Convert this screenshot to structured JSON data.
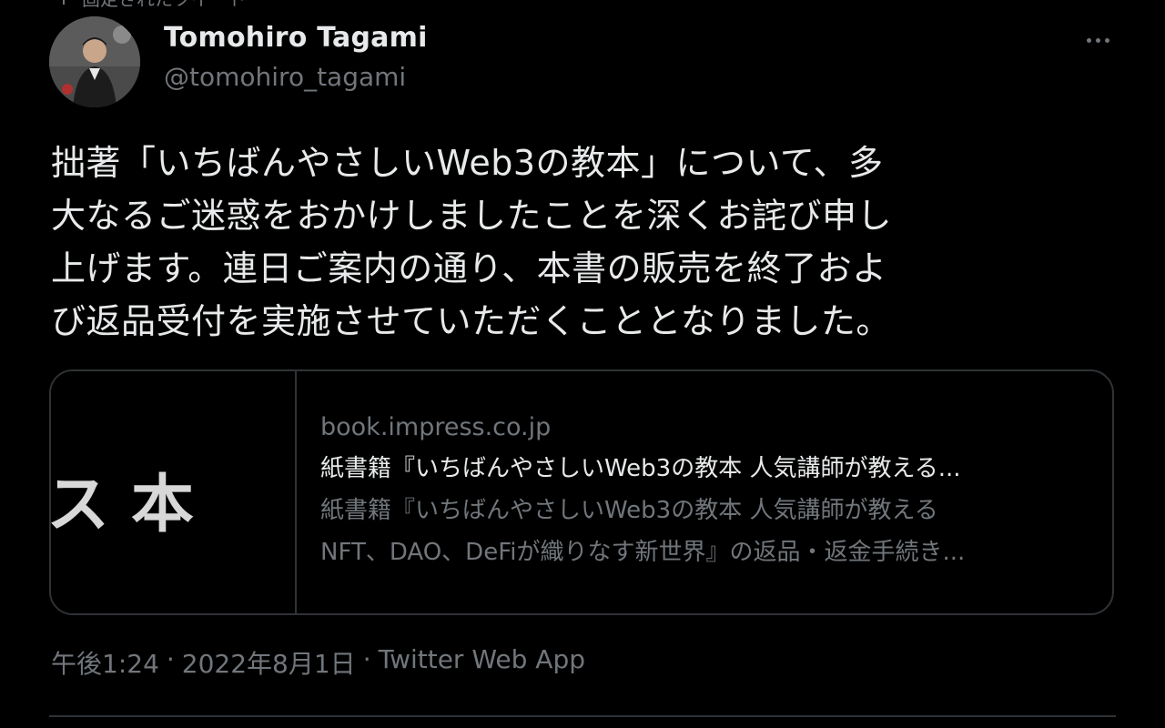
{
  "pinned": {
    "label": "固定されたツイート"
  },
  "author": {
    "name": "Tomohiro Tagami",
    "handle": "@tomohiro_tagami"
  },
  "tweet": {
    "lines": [
      "拙著「いちばんやさしいWeb3の教本」について、多",
      "大なるご迷惑をおかけしましたことを深くお詫び申し",
      "上げます。連日ご案内の通り、本書の販売を終了およ",
      "び返品受付を実施させていただくこととなりました。"
    ]
  },
  "card": {
    "domain": "book.impress.co.jp",
    "title": "紙書籍『いちばんやさしいWeb3の教本 人気講師が教える...",
    "description_lines": [
      "紙書籍『いちばんやさしいWeb3の教本 人気講師が教える",
      "NFT、DAO、DeFiが織りなす新世界』の返品・返金手続き..."
    ],
    "thumb_text": "ス 本"
  },
  "meta": {
    "time": "午後1:24",
    "sep1": "·",
    "date": "2022年8月1日",
    "sep2": "·",
    "source": "Twitter Web App"
  },
  "icons": {
    "more": "more-horizontal-icon",
    "pin": "pin-icon"
  },
  "colors": {
    "background": "#000000",
    "text": "#e7e9ea",
    "secondary": "#71767b",
    "border": "#2f3336"
  }
}
